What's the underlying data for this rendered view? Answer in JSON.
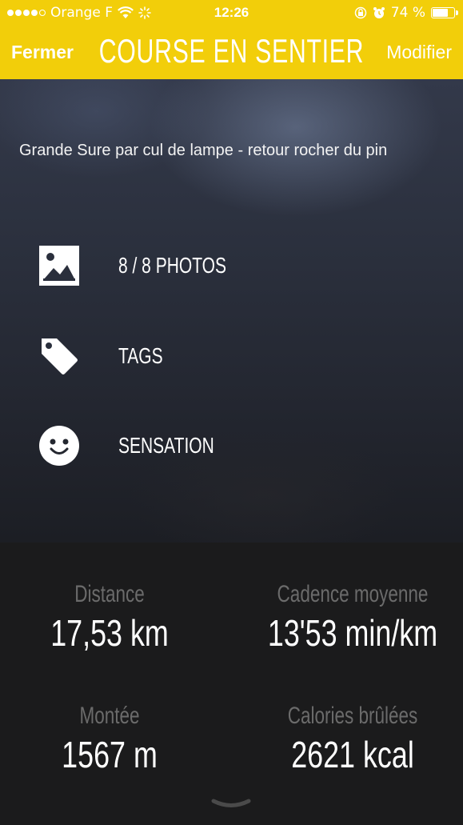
{
  "status_bar": {
    "carrier": "Orange F",
    "time": "12:26",
    "battery_percent": "74 %",
    "battery_level": 0.74
  },
  "nav": {
    "close_label": "Fermer",
    "title": "COURSE EN SENTIER",
    "edit_label": "Modifier"
  },
  "activity": {
    "description": "Grande Sure par cul de lampe - retour rocher du pin",
    "photos_label": "8 / 8 PHOTOS",
    "tags_label": "TAGS",
    "sensation_label": "SENSATION"
  },
  "stats": {
    "distance_label": "Distance",
    "distance_value": "17,53 km",
    "cadence_label": "Cadence moyenne",
    "cadence_value": "13'53 min/km",
    "climb_label": "Montée",
    "climb_value": "1567 m",
    "calories_label": "Calories brûlées",
    "calories_value": "2621 kcal"
  },
  "icons": [
    "signal-icon",
    "wifi-icon",
    "activity-icon",
    "rotation-lock-icon",
    "alarm-icon",
    "battery-icon",
    "image-icon",
    "tag-icon",
    "smiley-icon",
    "chevron-down-icon"
  ],
  "colors": {
    "accent": "#f2ce0a",
    "stats_bg": "#1b1b1c",
    "stat_label": "#6b6b6b"
  }
}
